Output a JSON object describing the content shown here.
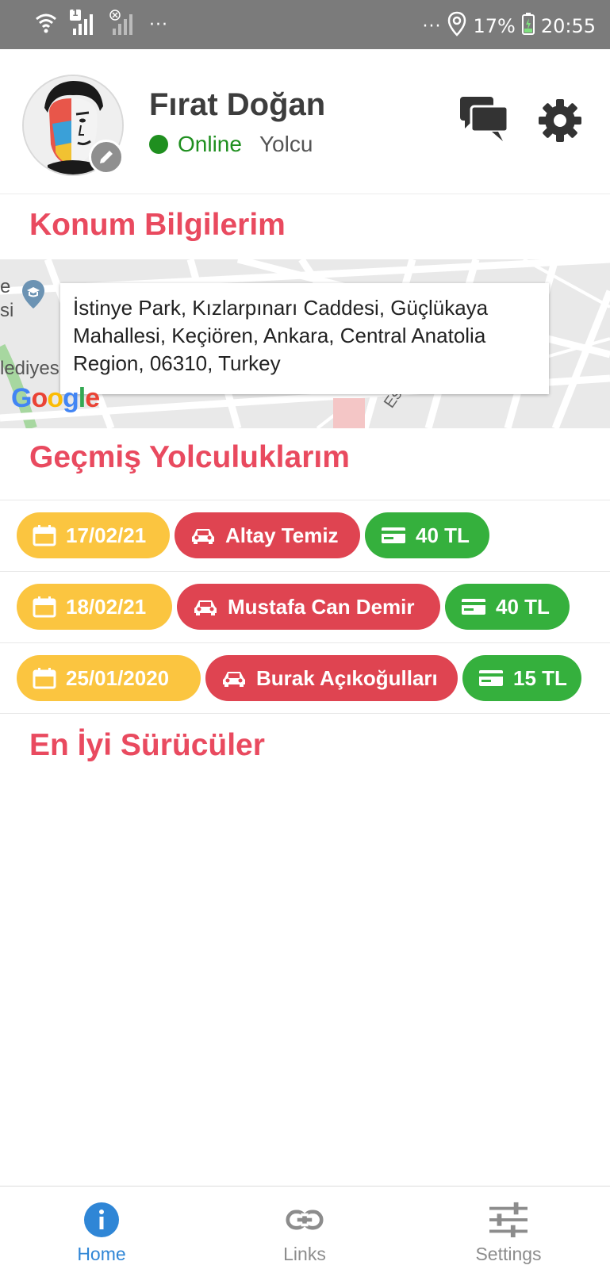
{
  "status_bar": {
    "overflow_left": "···",
    "overflow_right": "···",
    "battery": "17%",
    "time": "20:55",
    "sim_badge": "1"
  },
  "profile": {
    "name": "Fırat Doğan",
    "status": "Online",
    "role": "Yolcu",
    "status_color": "#1f8f1f"
  },
  "sections": {
    "location_title": "Konum Bilgilerim",
    "history_title": "Geçmiş Yolculuklarım",
    "drivers_title": "En İyi Sürücüler"
  },
  "map": {
    "address": "İstinye Park, Kızlarpınarı Caddesi, Güçlükaya Mahallesi, Keçiören, Ankara, Central Anatolia Region, 06310, Turkey",
    "label_left": "lediyes",
    "label_e": "e\nsi",
    "road_label": "Ese",
    "logo_text": "Google"
  },
  "rides": [
    {
      "date": "17/02/21",
      "driver": "Altay Temiz",
      "price": "40 TL"
    },
    {
      "date": "18/02/21",
      "driver": "Mustafa Can Demir",
      "price": "40 TL"
    },
    {
      "date": "25/01/2020",
      "driver": "Burak Açıkoğulları",
      "price": "15 TL"
    }
  ],
  "nav": {
    "home": "Home",
    "links": "Links",
    "settings": "Settings",
    "active_color": "#2f86d6",
    "inactive_color": "#8c8c8c"
  },
  "colors": {
    "accent": "#e94a5f",
    "date_chip": "#fbc540",
    "driver_chip": "#df4451",
    "price_chip": "#35b03d"
  }
}
